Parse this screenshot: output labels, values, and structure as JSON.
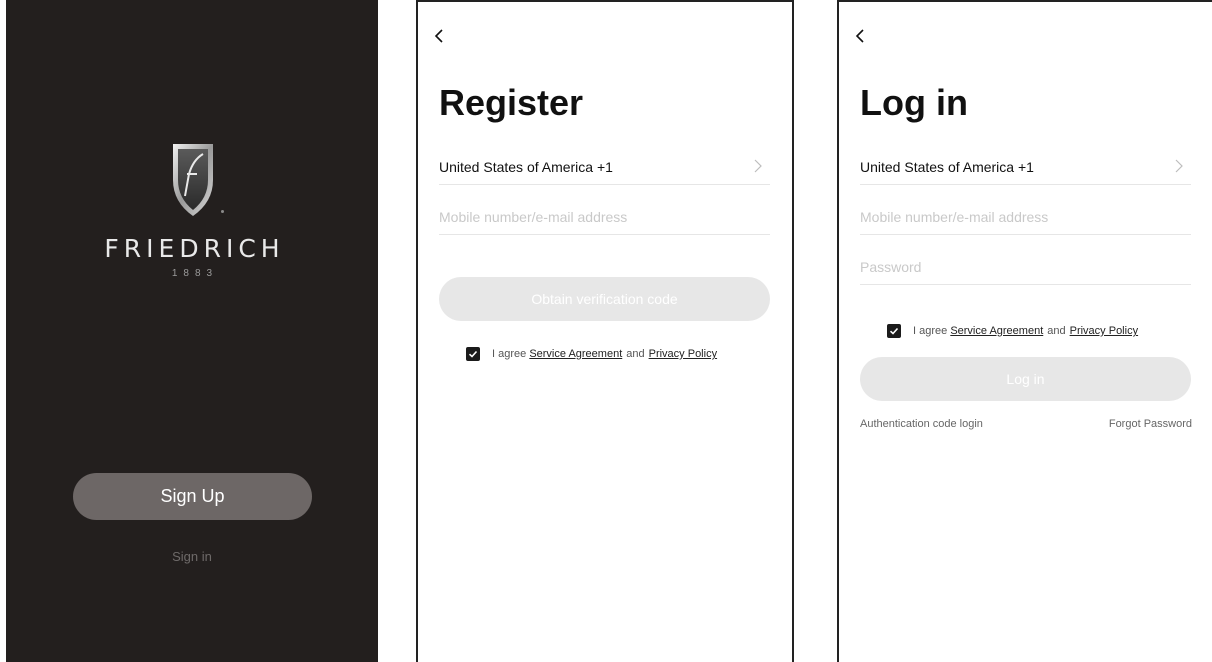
{
  "splash": {
    "brand": "FRIEDRICH",
    "year": "1883",
    "signup_label": "Sign Up",
    "signin_label": "Sign in",
    "colors": {
      "background": "#231f1e",
      "signup_button": "#6d6766"
    },
    "icons": {
      "logo": "friedrich-shield-logo"
    }
  },
  "register": {
    "back_icon": "chevron-left-icon",
    "title": "Register",
    "country_field": "United States of America +1",
    "account_placeholder": "Mobile number/e-mail address",
    "obtain_code_label": "Obtain verification code",
    "agree_prefix": "I agree",
    "service_agreement": "Service Agreement",
    "agree_and": "and",
    "privacy_policy": "Privacy Policy",
    "agree_checked": true
  },
  "login": {
    "back_icon": "chevron-left-icon",
    "title": "Log in",
    "country_field": "United States of America +1",
    "account_placeholder": "Mobile number/e-mail address",
    "password_placeholder": "Password",
    "agree_prefix": "I agree",
    "service_agreement": "Service Agreement",
    "agree_and": "and",
    "privacy_policy": "Privacy Policy",
    "agree_checked": true,
    "login_label": "Log in",
    "auth_code_login": "Authentication code login",
    "forgot_password": "Forgot Password"
  }
}
